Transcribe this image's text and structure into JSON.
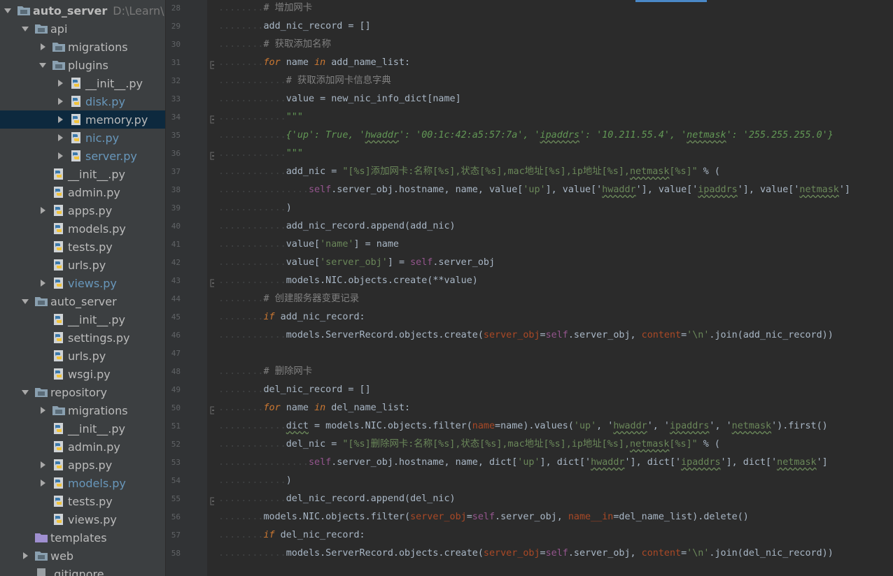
{
  "project_tree": {
    "root": {
      "name": "auto_server",
      "path": "D:\\Learn\\P"
    },
    "items": [
      {
        "label": "api",
        "type": "folder",
        "depth": 1,
        "expanded": true
      },
      {
        "label": "migrations",
        "type": "folder",
        "depth": 2,
        "expanded": false
      },
      {
        "label": "plugins",
        "type": "folder",
        "depth": 2,
        "expanded": true
      },
      {
        "label": "__init__.py",
        "type": "py",
        "depth": 3,
        "expandable": true
      },
      {
        "label": "disk.py",
        "type": "py",
        "depth": 3,
        "expandable": true,
        "modified": true
      },
      {
        "label": "memory.py",
        "type": "py",
        "depth": 3,
        "expandable": true,
        "selected": true
      },
      {
        "label": "nic.py",
        "type": "py",
        "depth": 3,
        "expandable": true,
        "modified": true
      },
      {
        "label": "server.py",
        "type": "py",
        "depth": 3,
        "expandable": true,
        "modified": true
      },
      {
        "label": "__init__.py",
        "type": "py",
        "depth": 2
      },
      {
        "label": "admin.py",
        "type": "py",
        "depth": 2
      },
      {
        "label": "apps.py",
        "type": "py",
        "depth": 2,
        "expandable": true
      },
      {
        "label": "models.py",
        "type": "py",
        "depth": 2
      },
      {
        "label": "tests.py",
        "type": "py",
        "depth": 2
      },
      {
        "label": "urls.py",
        "type": "py",
        "depth": 2
      },
      {
        "label": "views.py",
        "type": "py",
        "depth": 2,
        "expandable": true,
        "modified": true
      },
      {
        "label": "auto_server",
        "type": "folder",
        "depth": 1,
        "expanded": true
      },
      {
        "label": "__init__.py",
        "type": "py",
        "depth": 2
      },
      {
        "label": "settings.py",
        "type": "py",
        "depth": 2
      },
      {
        "label": "urls.py",
        "type": "py",
        "depth": 2
      },
      {
        "label": "wsgi.py",
        "type": "py",
        "depth": 2
      },
      {
        "label": "repository",
        "type": "folder",
        "depth": 1,
        "expanded": true
      },
      {
        "label": "migrations",
        "type": "folder",
        "depth": 2,
        "expanded": false
      },
      {
        "label": "__init__.py",
        "type": "py",
        "depth": 2
      },
      {
        "label": "admin.py",
        "type": "py",
        "depth": 2
      },
      {
        "label": "apps.py",
        "type": "py",
        "depth": 2,
        "expandable": true
      },
      {
        "label": "models.py",
        "type": "py",
        "depth": 2,
        "expandable": true,
        "modified": true
      },
      {
        "label": "tests.py",
        "type": "py",
        "depth": 2
      },
      {
        "label": "views.py",
        "type": "py",
        "depth": 2
      },
      {
        "label": "templates",
        "type": "folder-purple",
        "depth": 1
      },
      {
        "label": "web",
        "type": "folder",
        "depth": 1,
        "expanded": false
      },
      {
        "label": ".gitignore",
        "type": "file",
        "depth": 1
      }
    ]
  },
  "editor": {
    "line_numbers": [
      "28",
      "29",
      "30",
      "31",
      "32",
      "33",
      "34",
      "35",
      "36",
      "37",
      "38",
      "39",
      "40",
      "41",
      "42",
      "43",
      "44",
      "45",
      "46",
      "47",
      "48",
      "49",
      "50",
      "51",
      "52",
      "53",
      "54",
      "55",
      "56",
      "57",
      "58"
    ],
    "fold_lines": [
      "31",
      "34",
      "36",
      "43",
      "50",
      "55"
    ],
    "lines": [
      [
        [
          "dots",
          "........"
        ],
        [
          "cm",
          "# 增加网卡"
        ]
      ],
      [
        [
          "dots",
          "........"
        ],
        [
          "",
          "add_nic_record = []"
        ]
      ],
      [
        [
          "dots",
          "........"
        ],
        [
          "cm",
          "# 获取添加名称"
        ]
      ],
      [
        [
          "dots",
          "........"
        ],
        [
          "kw it",
          "for"
        ],
        [
          "",
          " name "
        ],
        [
          "kw it",
          "in"
        ],
        [
          "",
          " add_name_list:"
        ]
      ],
      [
        [
          "dots",
          "............"
        ],
        [
          "cm",
          "# 获取添加网卡信息字典"
        ]
      ],
      [
        [
          "dots",
          "............"
        ],
        [
          "",
          "value = new_nic_info_dict[name]"
        ]
      ],
      [
        [
          "dots",
          "............"
        ],
        [
          "docq",
          "\"\"\""
        ]
      ],
      [
        [
          "dots",
          "............"
        ],
        [
          "docq",
          "{'up': True, '"
        ],
        [
          "docq wavy",
          "hwaddr"
        ],
        [
          "docq",
          "': '00:1c:42:a5:57:7a', '"
        ],
        [
          "docq wavy",
          "ipaddrs"
        ],
        [
          "docq",
          "': '10.211.55.4', '"
        ],
        [
          "docq wavy",
          "netmask"
        ],
        [
          "docq",
          "': '255.255.255.0'}"
        ]
      ],
      [
        [
          "dots",
          "............"
        ],
        [
          "docq",
          "\"\"\""
        ]
      ],
      [
        [
          "dots",
          "............"
        ],
        [
          "",
          "add_nic = "
        ],
        [
          "st",
          "\"[%s]添加网卡:名称[%s],状态[%s],mac地址[%s],ip地址[%s],"
        ],
        [
          "st wavy",
          "netmask"
        ],
        [
          "st",
          "[%s]\""
        ],
        [
          "",
          " % ("
        ]
      ],
      [
        [
          "dots",
          "................"
        ],
        [
          "self",
          "self"
        ],
        [
          "",
          ".server_obj.hostname, name, value["
        ],
        [
          "st",
          "'up'"
        ],
        [
          "",
          "], value['"
        ],
        [
          "st wavy",
          "hwaddr"
        ],
        [
          "",
          "'], value['"
        ],
        [
          "st wavy",
          "ipaddrs"
        ],
        [
          "",
          "'], value['"
        ],
        [
          "st wavy",
          "netmask"
        ],
        [
          "",
          "']"
        ]
      ],
      [
        [
          "dots",
          "............"
        ],
        [
          "",
          ")"
        ]
      ],
      [
        [
          "dots",
          "............"
        ],
        [
          "",
          "add_nic_record.append(add_nic)"
        ]
      ],
      [
        [
          "dots",
          "............"
        ],
        [
          "",
          "value["
        ],
        [
          "st",
          "'name'"
        ],
        [
          "",
          "] = name"
        ]
      ],
      [
        [
          "dots",
          "............"
        ],
        [
          "",
          "value["
        ],
        [
          "st",
          "'server_obj'"
        ],
        [
          "",
          "] = "
        ],
        [
          "self",
          "self"
        ],
        [
          "",
          ".server_obj"
        ]
      ],
      [
        [
          "dots",
          "............"
        ],
        [
          "",
          "models.NIC.objects.create(**value)"
        ]
      ],
      [
        [
          "dots",
          "........"
        ],
        [
          "cm",
          "# 创建服务器变更记录"
        ]
      ],
      [
        [
          "dots",
          "........"
        ],
        [
          "kw it",
          "if"
        ],
        [
          "",
          " add_nic_record:"
        ]
      ],
      [
        [
          "dots",
          "............"
        ],
        [
          "",
          "models.ServerRecord.objects.create("
        ],
        [
          "param",
          "server_obj"
        ],
        [
          "",
          "="
        ],
        [
          "self",
          "self"
        ],
        [
          "",
          ".server_obj, "
        ],
        [
          "param",
          "content"
        ],
        [
          "",
          "="
        ],
        [
          "st",
          "'\\n'"
        ],
        [
          "",
          ".join(add_nic_record))"
        ]
      ],
      [
        [
          "dots",
          ""
        ]
      ],
      [
        [
          "dots",
          "........"
        ],
        [
          "cm",
          "# 删除网卡"
        ]
      ],
      [
        [
          "dots",
          "........"
        ],
        [
          "",
          "del_nic_record = []"
        ]
      ],
      [
        [
          "dots",
          "........"
        ],
        [
          "kw it",
          "for"
        ],
        [
          "",
          " name "
        ],
        [
          "kw it",
          "in"
        ],
        [
          "",
          " del_name_list:"
        ]
      ],
      [
        [
          "dots",
          "............"
        ],
        [
          "wavy",
          "dict"
        ],
        [
          "",
          " = models.NIC.objects.filter("
        ],
        [
          "param",
          "name"
        ],
        [
          "",
          "=name).values("
        ],
        [
          "st",
          "'up'"
        ],
        [
          "",
          ", '"
        ],
        [
          "st wavy",
          "hwaddr"
        ],
        [
          "",
          "', '"
        ],
        [
          "st wavy",
          "ipaddrs"
        ],
        [
          "",
          "', '"
        ],
        [
          "st wavy",
          "netmask"
        ],
        [
          "",
          "').first()"
        ]
      ],
      [
        [
          "dots",
          "............"
        ],
        [
          "",
          "del_nic = "
        ],
        [
          "st",
          "\"[%s]删除网卡:名称[%s],状态[%s],mac地址[%s],ip地址[%s],"
        ],
        [
          "st wavy",
          "netmask"
        ],
        [
          "st",
          "[%s]\""
        ],
        [
          "",
          " % ("
        ]
      ],
      [
        [
          "dots",
          "................"
        ],
        [
          "self",
          "self"
        ],
        [
          "",
          ".server_obj.hostname, name, dict["
        ],
        [
          "st",
          "'up'"
        ],
        [
          "",
          "], dict['"
        ],
        [
          "st wavy",
          "hwaddr"
        ],
        [
          "",
          "'], dict['"
        ],
        [
          "st wavy",
          "ipaddrs"
        ],
        [
          "",
          "'], dict['"
        ],
        [
          "st wavy",
          "netmask"
        ],
        [
          "",
          "']"
        ]
      ],
      [
        [
          "dots",
          "............"
        ],
        [
          "",
          ")"
        ]
      ],
      [
        [
          "dots",
          "............"
        ],
        [
          "",
          "del_nic_record.append(del_nic)"
        ]
      ],
      [
        [
          "dots",
          "........"
        ],
        [
          "",
          "models.NIC.objects.filter("
        ],
        [
          "param",
          "server_obj"
        ],
        [
          "",
          "="
        ],
        [
          "self",
          "self"
        ],
        [
          "",
          ".server_obj, "
        ],
        [
          "param",
          "name__in"
        ],
        [
          "",
          "=del_name_list).delete()"
        ]
      ],
      [
        [
          "dots",
          "........"
        ],
        [
          "kw it",
          "if"
        ],
        [
          "",
          " del_nic_record:"
        ]
      ],
      [
        [
          "dots",
          "............"
        ],
        [
          "",
          "models.ServerRecord.objects.create("
        ],
        [
          "param",
          "server_obj"
        ],
        [
          "",
          "="
        ],
        [
          "self",
          "self"
        ],
        [
          "",
          ".server_obj, "
        ],
        [
          "param",
          "content"
        ],
        [
          "",
          "="
        ],
        [
          "st",
          "'\\n'"
        ],
        [
          "",
          ".join(del_nic_record))"
        ]
      ]
    ]
  },
  "colors": {
    "background": "#2b2b2b",
    "tree_background": "#3c3f41",
    "selection": "#0d293e",
    "keyword": "#cc7832",
    "string": "#6a8759",
    "comment": "#808080",
    "self": "#94558d",
    "param": "#aa4926",
    "modified_file": "#6897bb"
  }
}
